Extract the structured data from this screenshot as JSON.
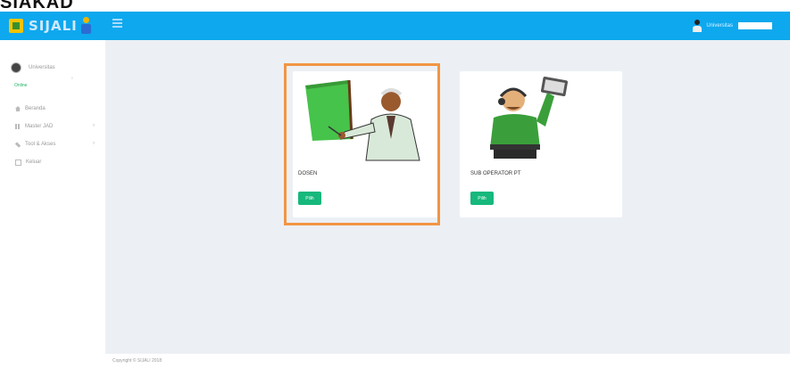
{
  "page_header": {
    "partial_text": "SIAKAD"
  },
  "topbar": {
    "logo_text": "SIJALI",
    "user_name": "Universitas"
  },
  "sidebar": {
    "profile_name": "Universitas",
    "status": "Online",
    "items": [
      {
        "label": "Beranda",
        "icon": "home-icon",
        "has_submenu": false
      },
      {
        "label": "Master JAD",
        "icon": "grid-icon",
        "has_submenu": true
      },
      {
        "label": "Tool & Akses",
        "icon": "wrench-icon",
        "has_submenu": true
      },
      {
        "label": "Keluar",
        "icon": "logout-icon",
        "has_submenu": false
      }
    ]
  },
  "cards": [
    {
      "title": "DOSEN",
      "button_label": "Pilih"
    },
    {
      "title": "SUB OPERATOR PT",
      "button_label": "Pilih"
    }
  ],
  "footer": {
    "text": "Copyright © SIJALI 2018"
  },
  "colors": {
    "topbar": "#0ea8ee",
    "content_bg": "#ecf0f5",
    "button": "#16b87c",
    "highlight": "#f29544"
  }
}
